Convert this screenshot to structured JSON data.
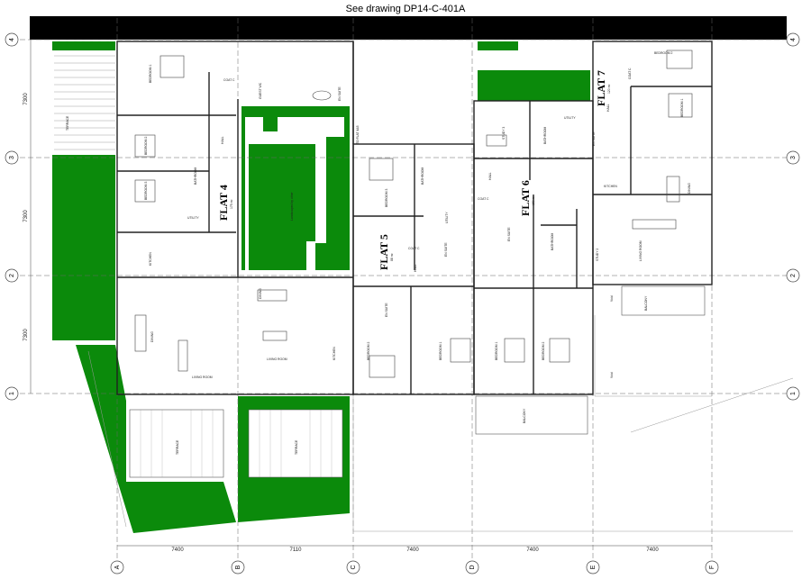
{
  "reference_note": "See drawing DP14-C-401A",
  "colors": {
    "green": "#0b8a0b",
    "wall": "#222222",
    "grid": "#555555",
    "banner": "#000000"
  },
  "column_grid": [
    "A",
    "B",
    "C",
    "D",
    "E",
    "F"
  ],
  "row_grid": [
    "1",
    "2",
    "3",
    "4"
  ],
  "column_spacings": [
    "7400",
    "7110",
    "7400",
    "7400",
    "7400"
  ],
  "row_spacings": [
    "7300",
    "7300",
    "7300"
  ],
  "flats": [
    {
      "name": "FLAT 4",
      "area": "175 m²"
    },
    {
      "name": "FLAT 5",
      "area": "88 m²"
    },
    {
      "name": "FLAT 6",
      "area": "150 m²"
    },
    {
      "name": "FLAT 7",
      "area": "120 m²"
    }
  ],
  "rooms": {
    "terrace": "TERRACE",
    "bedroom1": "BEDROOM 1",
    "bedroom2": "BEDROOM 2",
    "bedroom3": "BEDROOM 3",
    "ensuite": "EN SUITE",
    "guest_wc": "GUEST WC",
    "coat_c": "COAT C",
    "hall": "HALL",
    "bathroom": "BATHROOM",
    "utility": "UTILITY",
    "kitchen": "KITCHEN",
    "dining": "DINING",
    "living_room": "LIVING ROOM",
    "study": "STUDY",
    "study2": "STUDY 2",
    "study3": "STUDY 3",
    "balcony": "BALCONY",
    "void": "Void",
    "to_flat": "TO FLAT 4&5",
    "courtyard": "Landscaped by other"
  }
}
